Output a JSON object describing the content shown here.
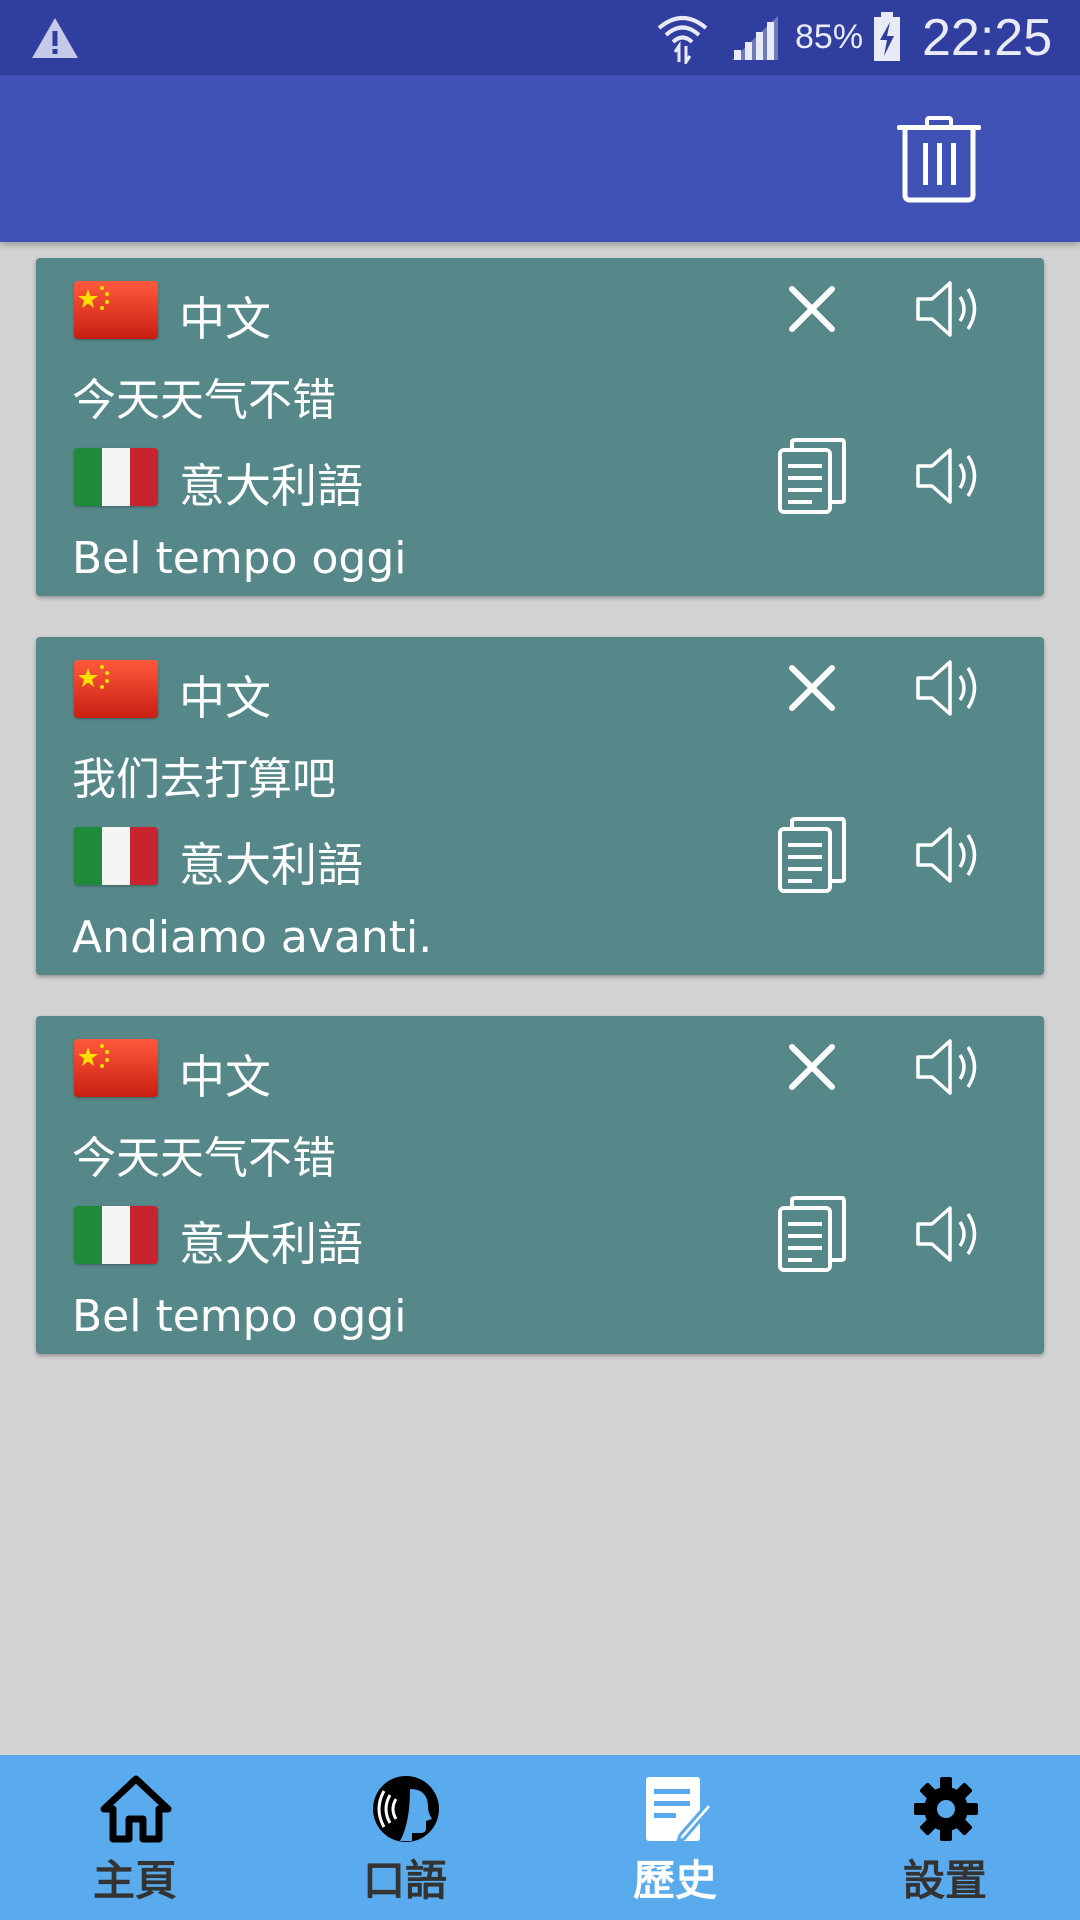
{
  "status_bar": {
    "battery": "85%",
    "time": "22:25"
  },
  "history": [
    {
      "source_lang": "中文",
      "source_text": "今天天气不错",
      "target_lang": "意大利語",
      "target_text": "Bel tempo oggi"
    },
    {
      "source_lang": "中文",
      "source_text": "我们去打算吧",
      "target_lang": "意大利語",
      "target_text": "Andiamo avanti."
    },
    {
      "source_lang": "中文",
      "source_text": "今天天气不错",
      "target_lang": "意大利語",
      "target_text": "Bel tempo oggi"
    }
  ],
  "nav": {
    "items": [
      {
        "label": "主頁",
        "icon": "home-icon"
      },
      {
        "label": "口語",
        "icon": "speak-icon"
      },
      {
        "label": "歷史",
        "icon": "history-icon",
        "active": true
      },
      {
        "label": "設置",
        "icon": "gear-icon"
      }
    ]
  },
  "colors": {
    "status_bar": "#303f9f",
    "app_bar": "#3f51b5",
    "card": "#568789",
    "bottom_nav": "#5aabee",
    "background": "#d3d3d3"
  }
}
